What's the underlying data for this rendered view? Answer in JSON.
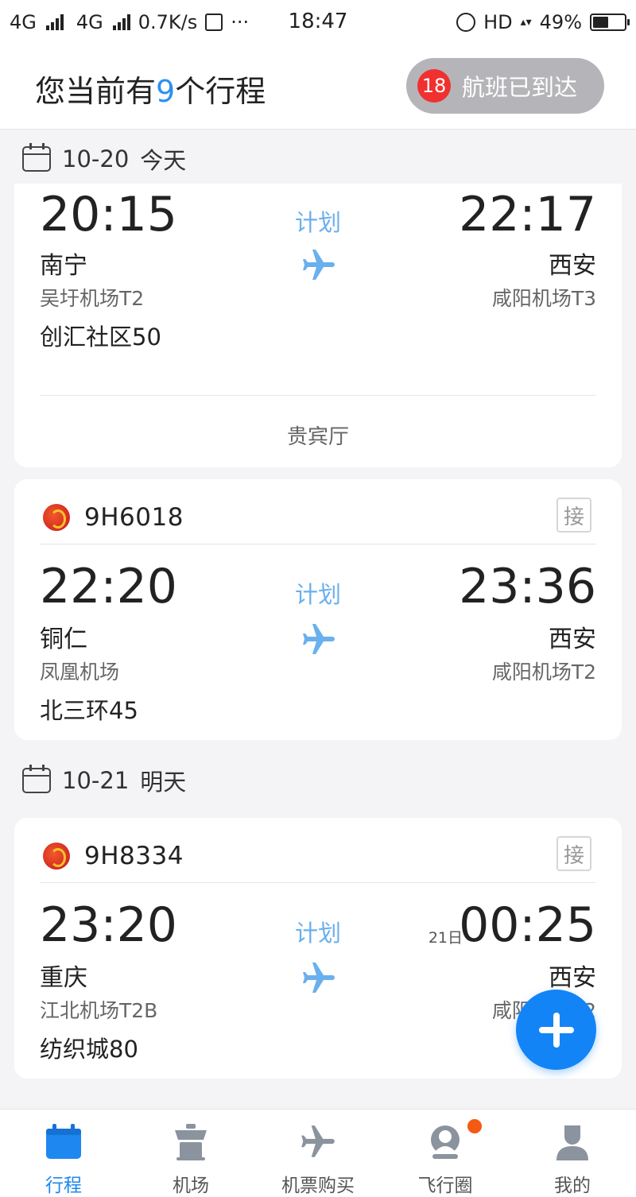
{
  "status_bar": {
    "net1": "4G",
    "net2": "4G",
    "speed": "0.7K/s",
    "time": "18:47",
    "hd": "HD",
    "battery": "49%"
  },
  "header": {
    "title_prefix": "您当前有",
    "count": "9",
    "title_suffix": "个行程",
    "arrived_count": "18",
    "arrived_label": "航班已到达"
  },
  "sections": [
    {
      "date": "10-20",
      "day": "今天"
    },
    {
      "date": "10-21",
      "day": "明天"
    }
  ],
  "flights": [
    {
      "flight_no": "",
      "dep_time": "20:15",
      "arr_time": "22:17",
      "arr_day": "",
      "status": "计划",
      "dep_city": "南宁",
      "dep_airport": "吴圩机场T2",
      "arr_city": "西安",
      "arr_airport": "咸阳机场T3",
      "gate": "创汇社区50",
      "lounge": "贵宾厅"
    },
    {
      "flight_no": "9H6018",
      "pickup": "接",
      "dep_time": "22:20",
      "arr_time": "23:36",
      "arr_day": "",
      "status": "计划",
      "dep_city": "铜仁",
      "dep_airport": "凤凰机场",
      "arr_city": "西安",
      "arr_airport": "咸阳机场T2",
      "gate": "北三环45"
    },
    {
      "flight_no": "9H8334",
      "pickup": "接",
      "dep_time": "23:20",
      "arr_time": "00:25",
      "arr_day": "21日",
      "status": "计划",
      "dep_city": "重庆",
      "dep_airport": "江北机场T2B",
      "arr_city": "西安",
      "arr_airport": "咸阳机场T2",
      "gate": "纺织城80"
    }
  ],
  "tabs": [
    {
      "label": "行程",
      "icon": "calendar-icon"
    },
    {
      "label": "机场",
      "icon": "control-tower-icon"
    },
    {
      "label": "机票购买",
      "icon": "airplane-icon"
    },
    {
      "label": "飞行圈",
      "icon": "community-icon"
    },
    {
      "label": "我的",
      "icon": "user-icon"
    }
  ],
  "colors": {
    "accent": "#1e88f0",
    "fab": "#1384f6",
    "status_text": "#6ab0ee",
    "badge": "#f0312f",
    "notify_dot": "#f45a12"
  }
}
